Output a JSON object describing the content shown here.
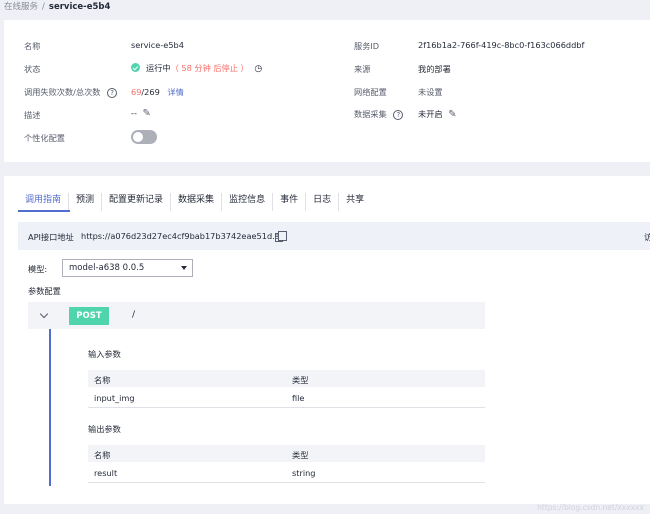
{
  "breadcrumb": {
    "parent": "在线服务",
    "separator": "/",
    "current": "service-e5b4"
  },
  "info": {
    "name_label": "名称",
    "name_value": "service-e5b4",
    "status_label": "状态",
    "status_value": "运行中",
    "status_note": "（ 58 分钟 后停止 ）",
    "calls_label": "调用失败次数/总次数",
    "calls_failed": "69",
    "calls_total": "/269",
    "calls_detail_link": "详情",
    "desc_label": "描述",
    "desc_value": "--",
    "personalize_label": "个性化配置",
    "service_id_label": "服务ID",
    "service_id_value": "2f16b1a2-766f-419c-8bc0-f163c066ddbf",
    "source_label": "来源",
    "source_value": "我的部署",
    "network_label": "网络配置",
    "network_value": "未设置",
    "data_collect_label": "数据采集",
    "data_collect_value": "未开启",
    "personalize_enabled": false
  },
  "tabs": [
    "调用指南",
    "预测",
    "配置更新记录",
    "数据采集",
    "监控信息",
    "事件",
    "日志",
    "共享"
  ],
  "api": {
    "label": "API接口地址",
    "url": "https://a076d23d27ec4cf9bab17b3742eae51d.a",
    "right_cut": "访"
  },
  "model": {
    "label": "模型:",
    "selected": "model-a638 0.0.5"
  },
  "params_label": "参数配置",
  "endpoint": {
    "method": "POST",
    "path": "/"
  },
  "input_params": {
    "title": "输入参数",
    "headers": [
      "名称",
      "类型"
    ],
    "rows": [
      [
        "input_img",
        "file"
      ]
    ]
  },
  "output_params": {
    "title": "输出参数",
    "headers": [
      "名称",
      "类型"
    ],
    "rows": [
      [
        "result",
        "string"
      ]
    ]
  },
  "watermark": "https://blog.csdn.net/xxxxxx",
  "colors": {
    "accent": "#526ecc",
    "success": "#50d4ab",
    "danger": "#f66f6a"
  }
}
